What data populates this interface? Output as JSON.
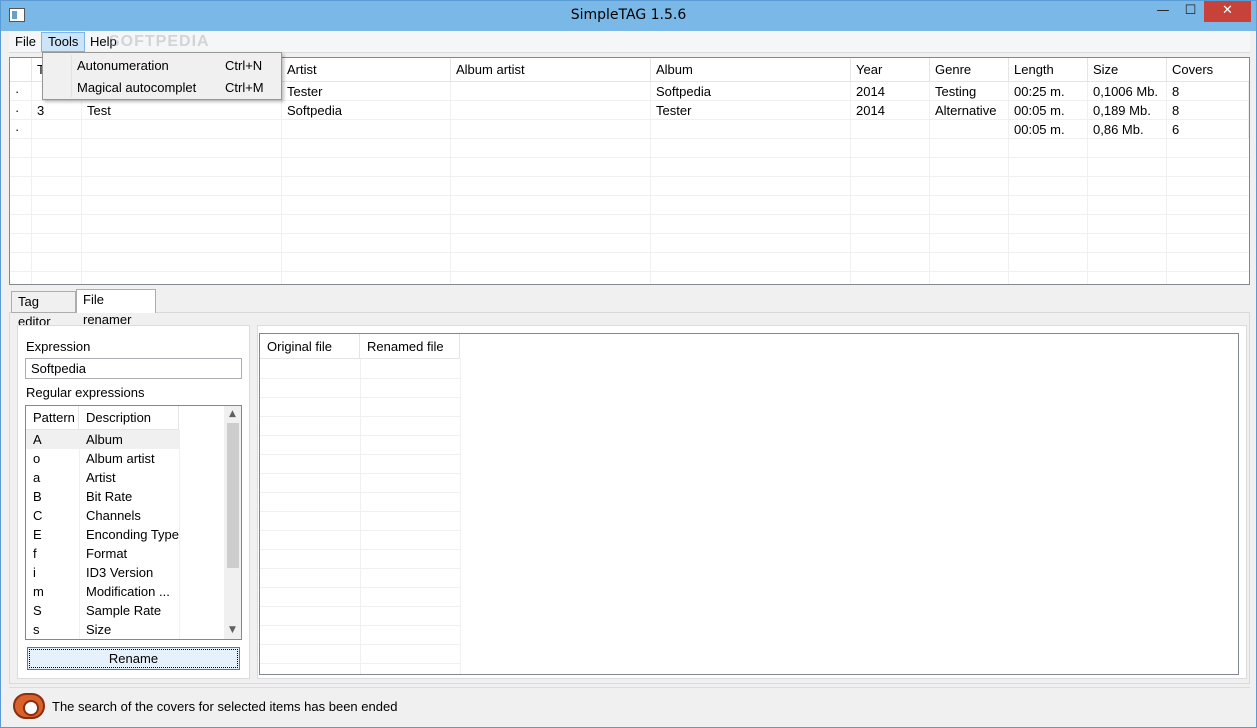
{
  "window": {
    "title": "SimpleTAG 1.5.6",
    "minimize": "—",
    "maximize": "☐",
    "close": "✕"
  },
  "menubar": {
    "file": "File",
    "tools": "Tools",
    "help": "Help",
    "watermark": "SOFTPEDIA"
  },
  "tools_menu": {
    "items": [
      {
        "label": "Autonumeration",
        "shortcut": "Ctrl+N"
      },
      {
        "label": "Magical autocomplet",
        "shortcut": "Ctrl+M"
      }
    ]
  },
  "tracks": {
    "columns": [
      "T",
      "",
      "Artist",
      "Album artist",
      "Album",
      "Year",
      "Genre",
      "Length",
      "Size",
      "Covers"
    ],
    "rows": [
      {
        "marker": "·",
        "track": "",
        "title": "",
        "artist": "Tester",
        "album_artist": "",
        "album": "Softpedia",
        "year": "2014",
        "genre": "Testing",
        "length": "00:25 m.",
        "size": "0,1006 Mb.",
        "covers": "8"
      },
      {
        "marker": "·",
        "track": "3",
        "title": "Test",
        "artist": "Softpedia",
        "album_artist": "",
        "album": "Tester",
        "year": "2014",
        "genre": "Alternative",
        "length": "00:05 m.",
        "size": "0,189 Mb.",
        "covers": "8"
      },
      {
        "marker": "·",
        "track": "",
        "title": "",
        "artist": "",
        "album_artist": "",
        "album": "",
        "year": "",
        "genre": "",
        "length": "00:05 m.",
        "size": "0,86 Mb.",
        "covers": "6"
      }
    ]
  },
  "tabs": {
    "tag_editor": "Tag editor",
    "file_renamer": "File renamer",
    "active": "File renamer"
  },
  "renamer": {
    "expression_label": "Expression",
    "expression_value": "Softpedia",
    "regex_label": "Regular expressions",
    "regex_columns": [
      "Pattern",
      "Description"
    ],
    "regex_rows": [
      {
        "pattern": "A",
        "description": "Album"
      },
      {
        "pattern": "o",
        "description": "Album artist"
      },
      {
        "pattern": "a",
        "description": "Artist"
      },
      {
        "pattern": "B",
        "description": "Bit Rate"
      },
      {
        "pattern": "C",
        "description": "Channels"
      },
      {
        "pattern": "E",
        "description": "Enconding Type"
      },
      {
        "pattern": "f",
        "description": "Format"
      },
      {
        "pattern": "i",
        "description": "ID3 Version"
      },
      {
        "pattern": "m",
        "description": "Modification ..."
      },
      {
        "pattern": "S",
        "description": "Sample Rate"
      },
      {
        "pattern": "s",
        "description": "Size"
      }
    ],
    "rename_button": "Rename",
    "file_columns": [
      "Original file",
      "Renamed file"
    ]
  },
  "status": {
    "message": "The search of the covers for selected items has been ended"
  },
  "colors": {
    "titlebar": "#7ab8e8",
    "close_button": "#c7433a",
    "menu_highlight": "#cce4f7",
    "status_icon": "#d9622b"
  }
}
